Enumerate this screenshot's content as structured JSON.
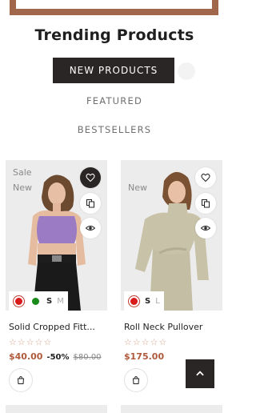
{
  "section": {
    "title": "Trending Products"
  },
  "tabs": {
    "active": "NEW PRODUCTS",
    "featured": "FEATURED",
    "bestsellers": "BESTSELLERS"
  },
  "products": [
    {
      "badges": {
        "sale": "Sale",
        "new": "New"
      },
      "name": "Solid Cropped Fitt...",
      "rating": "☆☆☆☆☆",
      "price": "$40.00",
      "discount": "-50%",
      "old_price": "$80.00",
      "sizes": [
        "S",
        "M"
      ],
      "colors": [
        "#d91b1b",
        "#1a8a1a"
      ]
    },
    {
      "badges": {
        "new": "New"
      },
      "name": "Roll Neck Pullover",
      "rating": "☆☆☆☆☆",
      "price": "$175.00",
      "sizes": [
        "S",
        "L"
      ],
      "colors": [
        "#d91b1b"
      ]
    }
  ],
  "icons": {
    "wishlist": "heart-icon",
    "compare": "compare-icon",
    "quick_view": "eye-icon",
    "cart": "cart-icon",
    "back_to_top": "chevron-up-icon"
  },
  "colors": {
    "accent": "#b05a3c",
    "dark": "#2b2626",
    "banner": "#a0674a"
  }
}
